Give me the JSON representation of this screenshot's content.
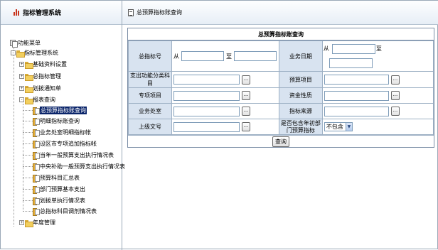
{
  "sidebar": {
    "title": "指标管理系统",
    "tree": {
      "root": "功能菜单",
      "system": "指标管理系统",
      "items": [
        {
          "label": "基础资料设置",
          "expander": "+"
        },
        {
          "label": "总指标管理",
          "expander": "+"
        },
        {
          "label": "划拨通知单",
          "expander": "+"
        },
        {
          "label": "报表查询",
          "expander": "-"
        }
      ],
      "reports": [
        "总预算指标账查询",
        "明细指标账查询",
        "业务处室明细指标帐",
        "设区市专项追加指标帐",
        "当年一般预算支出执行情况表",
        "中央补助一般预算支出执行情况表",
        "预算科目汇总表",
        "部门预算基本支出",
        "划拨单执行情况表",
        "总指标科目调剂情况表"
      ],
      "last": {
        "label": "年度管理",
        "expander": "+"
      },
      "selected_index": 0
    }
  },
  "main": {
    "page_title": "总预算指标账查询",
    "form": {
      "title": "总预算指标账查询",
      "fields": {
        "total_indicator_no": {
          "label": "总指标号",
          "from": "从",
          "to": "至"
        },
        "business_date": {
          "label": "业务日期",
          "from": "从",
          "to": "至"
        },
        "expenditure_subject": {
          "label": "支出功能分类科目"
        },
        "budget_item": {
          "label": "预算项目"
        },
        "special_item": {
          "label": "专项项目"
        },
        "fund_nature": {
          "label": "资金性质"
        },
        "business_office": {
          "label": "业务处室"
        },
        "indicator_source": {
          "label": "指标来源"
        },
        "superior_doc_no": {
          "label": "上级文号"
        },
        "include_initial": {
          "label": "是否包含年初部门预算指标",
          "selected": "不包含"
        }
      },
      "dots": "...",
      "query_button": "查询"
    }
  }
}
